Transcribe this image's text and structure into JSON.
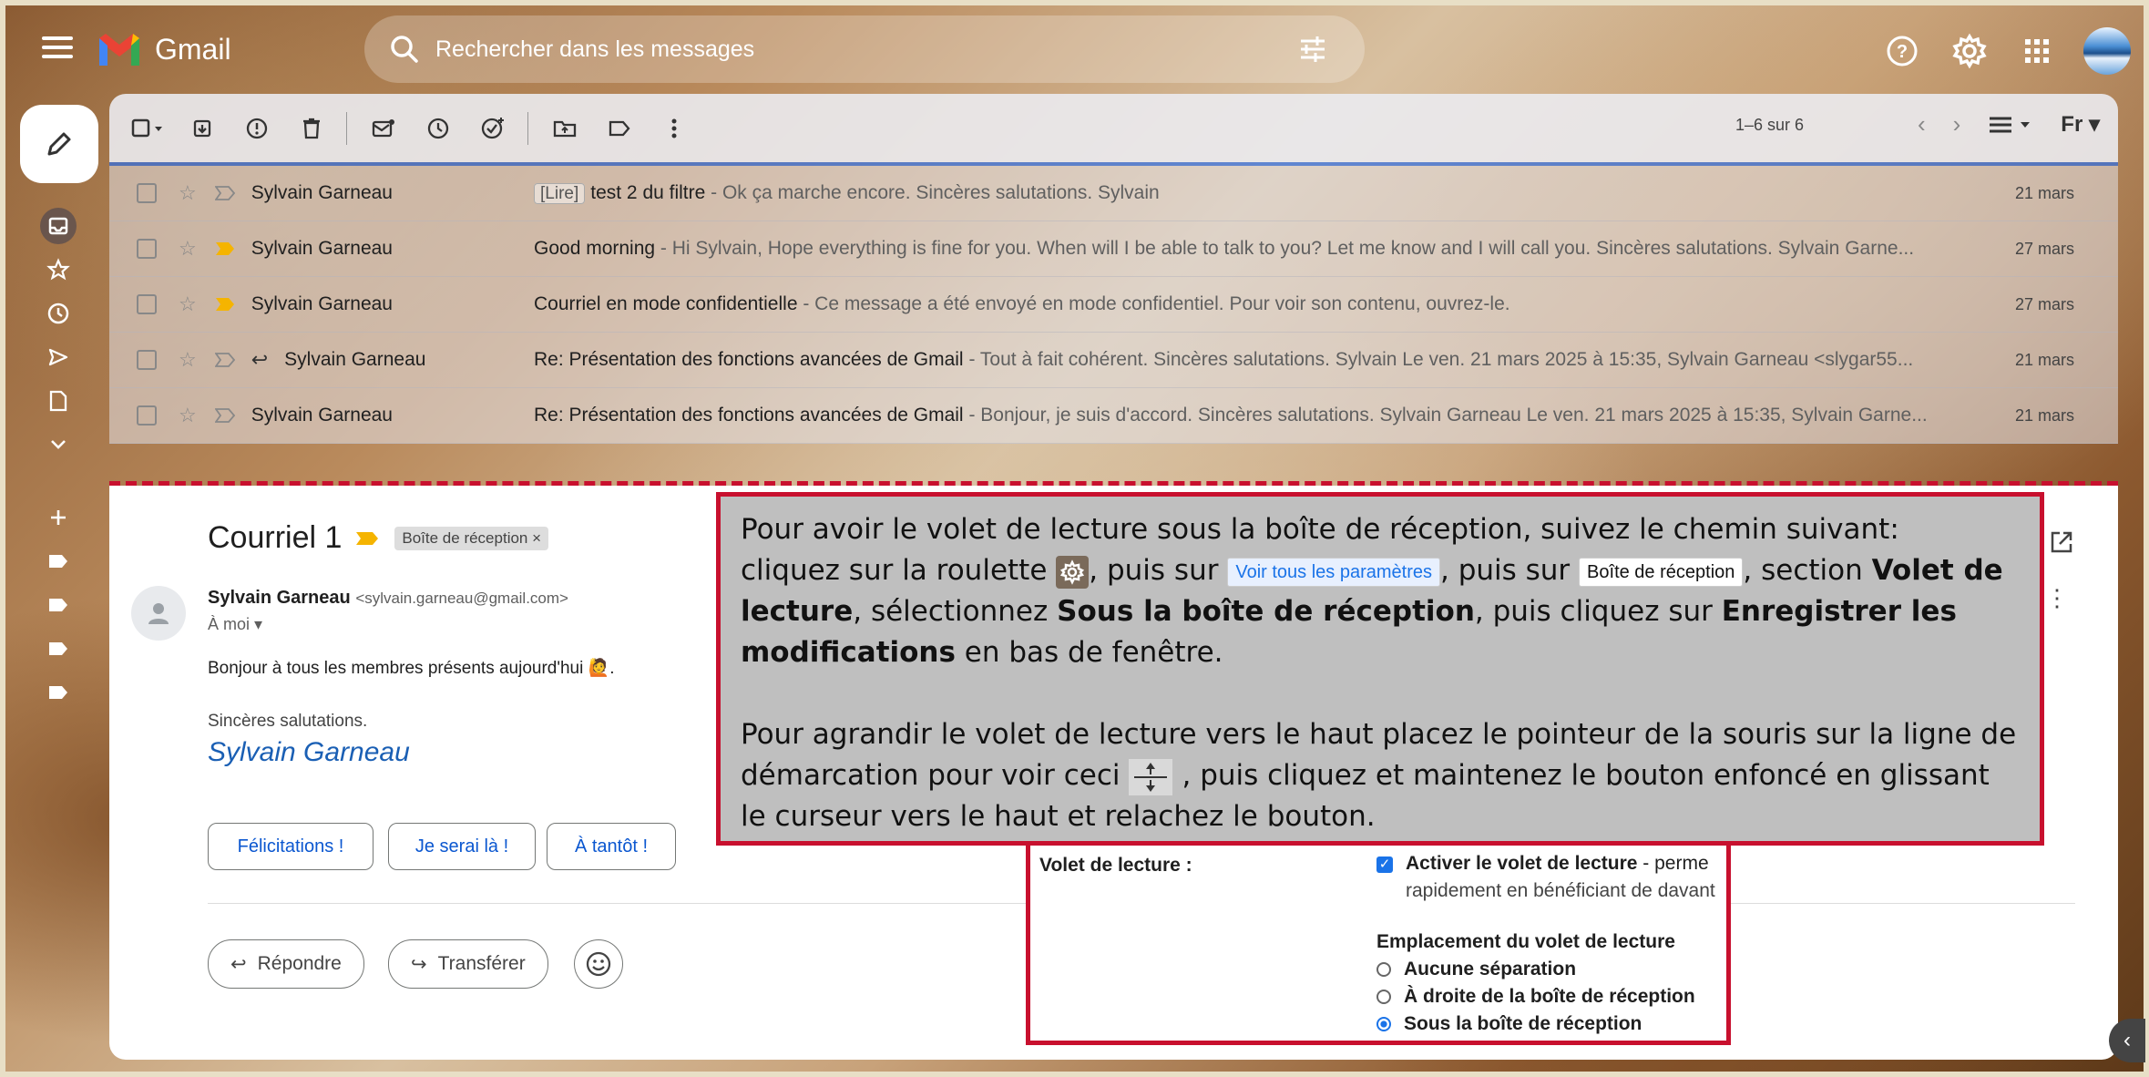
{
  "app": {
    "name": "Gmail"
  },
  "search": {
    "placeholder": "Rechercher dans les messages"
  },
  "toolbar": {
    "pagination": "1–6 sur 6",
    "input_tool": "Fr"
  },
  "emails": [
    {
      "sender": "Sylvain Garneau",
      "label": "[Lire]",
      "subject": "test 2 du filtre",
      "snippet": " - Ok ça marche encore. Sincères salutations. Sylvain",
      "date": "21 mars",
      "important": false,
      "replied": false
    },
    {
      "sender": "Sylvain Garneau",
      "label": "",
      "subject": "Good morning",
      "snippet": " - Hi Sylvain, Hope everything is fine for you. When will I be able to talk to you? Let me know and I will call you. Sincères salutations. Sylvain Garne...",
      "date": "27 mars",
      "important": true,
      "replied": false
    },
    {
      "sender": "Sylvain Garneau",
      "label": "",
      "subject": "Courriel en mode confidentielle",
      "snippet": " - Ce message a été envoyé en mode confidentiel. Pour voir son contenu, ouvrez-le.",
      "date": "27 mars",
      "important": true,
      "replied": false
    },
    {
      "sender": "Sylvain Garneau",
      "label": "",
      "subject": "Re: Présentation des fonctions avancées de Gmail",
      "snippet": " - Tout à fait cohérent. Sincères salutations. Sylvain Le ven. 21 mars 2025 à 15:35, Sylvain Garneau <slygar55...",
      "date": "21 mars",
      "important": false,
      "replied": true
    },
    {
      "sender": "Sylvain Garneau",
      "label": "",
      "subject": "Re: Présentation des fonctions avancées de Gmail",
      "snippet": " - Bonjour, je suis d'accord. Sincères salutations. Sylvain Garneau Le ven. 21 mars 2025 à 15:35, Sylvain Garne...",
      "date": "21 mars",
      "important": false,
      "replied": false
    }
  ],
  "reading": {
    "title": "Courriel 1",
    "chip": "Boîte de réception ×",
    "from_name": "Sylvain Garneau",
    "from_email": "<sylvain.garneau@gmail.com>",
    "to": "À moi ▾",
    "body1": "Bonjour à tous les membres présents aujourd'hui 🙋.",
    "body2": "Sincères salutations.",
    "signature": "Sylvain Garneau",
    "quick_replies": [
      "Félicitations !",
      "Je serai là !",
      "À tantôt !"
    ],
    "reply": "Répondre",
    "forward": "Transférer"
  },
  "settings": {
    "label": "Volet de lecture :",
    "activate_bold": "Activer le volet de lecture",
    "activate_rest": " - perme",
    "activate_line2": "rapidement en bénéficiant de davant",
    "placement_title": "Emplacement du volet de lecture",
    "options": [
      "Aucune séparation",
      "À droite de la boîte de réception",
      "Sous la boîte de réception"
    ],
    "selected_index": 2
  },
  "callout": {
    "l1": "Pour avoir le volet de lecture sous la boîte de réception, suivez le chemin suivant:",
    "l2a": "cliquez sur la roulette",
    "l2b": ", puis sur",
    "kb1": "Voir tous les paramètres",
    "l2c": ", puis sur",
    "kb2": "Boîte de réception",
    "l2d": ", section",
    "b1": "Volet de lecture",
    "l3a": ", sélectionnez",
    "b2": "Sous la boîte de réception",
    "l3b": ", puis cliquez sur",
    "b3": "Enregistrer les modifications",
    "l4": " en bas de fenêtre.",
    "p2a": "Pour agrandir le volet de lecture vers le haut placez le pointeur de la souris sur la ligne de démarcation pour voir ceci",
    "p2b": ", puis cliquez et maintenez le bouton enfoncé en glissant le curseur vers le haut et relachez le bouton."
  }
}
